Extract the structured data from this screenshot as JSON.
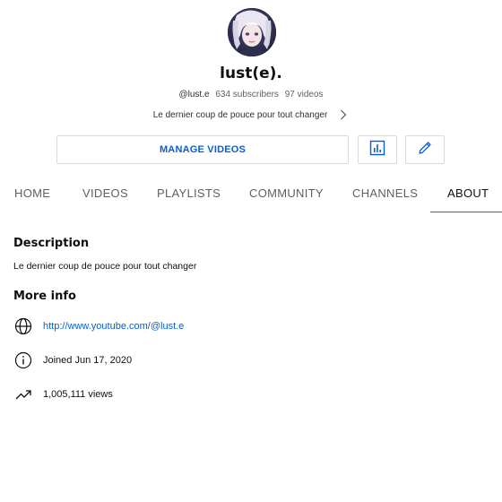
{
  "channel": {
    "name": "lust(e).",
    "handle": "@lust.e",
    "subscribers": "634 subscribers",
    "videos": "97 videos",
    "tagline": "Le dernier coup de pouce pour tout changer"
  },
  "actions": {
    "manage_videos": "MANAGE VIDEOS",
    "analytics_icon": "analytics-icon",
    "edit_icon": "pencil-icon"
  },
  "tabs": [
    {
      "label": "HOME",
      "active": false
    },
    {
      "label": "VIDEOS",
      "active": false
    },
    {
      "label": "PLAYLISTS",
      "active": false
    },
    {
      "label": "COMMUNITY",
      "active": false
    },
    {
      "label": "CHANNELS",
      "active": false
    },
    {
      "label": "ABOUT",
      "active": true
    }
  ],
  "about": {
    "description_title": "Description",
    "description": "Le dernier coup de pouce pour tout changer",
    "more_info_title": "More info",
    "link": "http://www.youtube.com/@lust.e",
    "joined": "Joined Jun 17, 2020",
    "views": "1,005,111 views"
  },
  "colors": {
    "link": "#065fd4",
    "text_primary": "#0f0f0f",
    "text_secondary": "#606060"
  }
}
